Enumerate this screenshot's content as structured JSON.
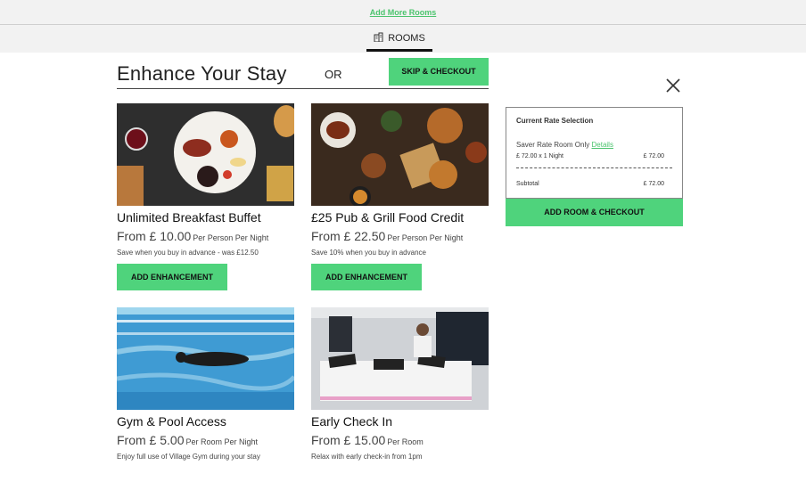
{
  "top": {
    "add_more_rooms": "Add More Rooms"
  },
  "tabs": {
    "rooms": "ROOMS"
  },
  "header": {
    "title": "Enhance Your Stay",
    "or": "OR",
    "skip_label": "SKIP & CHECKOUT"
  },
  "enhancements": [
    {
      "title": "Unlimited Breakfast Buffet",
      "price": "From £ 10.00",
      "unit": "Per Person Per Night",
      "desc": "Save when you buy in advance - was £12.50",
      "button": "ADD ENHANCEMENT"
    },
    {
      "title": "£25 Pub & Grill Food Credit",
      "price": "From £ 22.50",
      "unit": "Per Person Per Night",
      "desc": "Save 10% when you buy in advance",
      "button": "ADD ENHANCEMENT"
    },
    {
      "title": "Gym & Pool Access",
      "price": "From £ 5.00",
      "unit": "Per Room Per Night",
      "desc": "Enjoy full use of Village Gym during your stay"
    },
    {
      "title": "Early Check In",
      "price": "From £ 15.00",
      "unit": "Per Room",
      "desc": "Relax with early check-in from 1pm"
    }
  ],
  "rate": {
    "heading": "Current Rate Selection",
    "room": "Saver Rate Room Only",
    "details_link": "Details",
    "line": "£ 72.00 x 1 Night",
    "line_amount": "£ 72.00",
    "subtotal_label": "Subtotal",
    "subtotal_amount": "£ 72.00",
    "checkout_label": "ADD ROOM & CHECKOUT"
  },
  "colors": {
    "accent": "#4fd37c",
    "link": "#4cc46e"
  },
  "icons": {
    "rooms_tab": "building-icon",
    "close": "close-icon"
  }
}
